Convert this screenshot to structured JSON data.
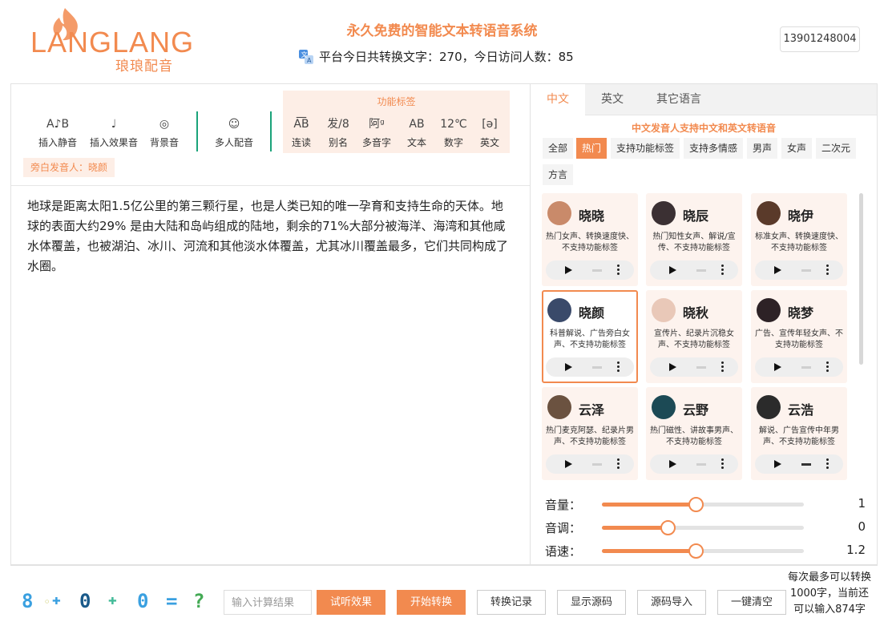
{
  "brand": {
    "logo_text": "LANGLANG",
    "logo_sub": "琅琅配音"
  },
  "header": {
    "title": "永久免费的智能文本转语音系统",
    "stats": "平台今日共转换文字：270，今日访问人数：85",
    "phone": "13901248004"
  },
  "toolbar": {
    "items": [
      {
        "icon": "A♪B",
        "label": "插入静音"
      },
      {
        "icon": "♩",
        "label": "插入效果音"
      },
      {
        "icon": "◎",
        "label": "背景音"
      },
      {
        "icon": "☺",
        "label": "多人配音"
      }
    ],
    "function_tags_title": "功能标签",
    "function_tags": [
      {
        "icon": "A͞B",
        "label": "连读"
      },
      {
        "icon": "发/8",
        "label": "别名"
      },
      {
        "icon": "阿ᵍ",
        "label": "多音字"
      },
      {
        "icon": "AB",
        "label": "文本"
      },
      {
        "icon": "12℃",
        "label": "数字"
      },
      {
        "icon": "[ə]",
        "label": "英文"
      }
    ],
    "narrator": "旁白发音人：晓颜"
  },
  "editor": {
    "text": "地球是距离太阳1.5亿公里的第三颗行星，也是人类已知的唯一孕育和支持生命的天体。地球的表面大约29% 是由大陆和岛屿组成的陆地，剩余的71%大部分被海洋、海湾和其他咸水体覆盖，也被湖泊、冰川、河流和其他淡水体覆盖，尤其冰川覆盖最多，它们共同构成了水圈。"
  },
  "voice_panel": {
    "tabs": [
      "中文",
      "英文",
      "其它语言"
    ],
    "note": "中文发音人支持中文和英文转语音",
    "filters": [
      "全部",
      "热门",
      "支持功能标签",
      "支持多情感",
      "男声",
      "女声",
      "二次元",
      "方言"
    ],
    "voices": [
      {
        "name": "晓晓",
        "desc": "热门女声、转换速度快、不支持功能标签",
        "color": "#c98a6a"
      },
      {
        "name": "晓辰",
        "desc": "热门知性女声、解说/宣传、不支持功能标签",
        "color": "#3b3033"
      },
      {
        "name": "晓伊",
        "desc": "标准女声、转换速度快、不支持功能标签",
        "color": "#5a3a2a"
      },
      {
        "name": "晓颜",
        "desc": "科普解说、广告旁白女声、不支持功能标签",
        "color": "#3a4a6a"
      },
      {
        "name": "晓秋",
        "desc": "宣传片、纪录片沉稳女声、不支持功能标签",
        "color": "#e9c8b8"
      },
      {
        "name": "晓梦",
        "desc": "广告、宣传年轻女声、不支持功能标签",
        "color": "#2d2226"
      },
      {
        "name": "云泽",
        "desc": "热门麦克阿瑟、纪录片男声、不支持功能标签",
        "color": "#6b5240"
      },
      {
        "name": "云野",
        "desc": "热门磁性、讲故事男声、不支持功能标签",
        "color": "#1c4a55"
      },
      {
        "name": "云浩",
        "desc": "解说、广告宣传中年男声、不支持功能标签",
        "color": "#2b2b2b"
      }
    ],
    "sliders": [
      {
        "label": "音量：",
        "value": "1",
        "fraction": 0.47
      },
      {
        "label": "音调：",
        "value": "0",
        "fraction": 0.33
      },
      {
        "label": "语速：",
        "value": "1.2",
        "fraction": 0.47
      }
    ]
  },
  "bottom": {
    "captcha": [
      {
        "ch": "8",
        "color": "#3aa0e0"
      },
      {
        "ch": "◦",
        "color": "#cccc66"
      },
      {
        "ch": "✚",
        "color": "#3aa0e0"
      },
      {
        "ch": "0",
        "color": "#1a5a8a"
      },
      {
        "ch": "✚",
        "color": "#44bb99"
      },
      {
        "ch": "0",
        "color": "#3aa0e0"
      },
      {
        "ch": "=",
        "color": "#3aa0e0"
      },
      {
        "ch": "?",
        "color": "#44aa55"
      }
    ],
    "input_placeholder": "输入计算结果",
    "buttons": [
      "试听效果",
      "开始转换",
      "转换记录",
      "显示源码",
      "源码导入",
      "一键清空"
    ],
    "limit_note": "每次最多可以转换1000字，当前还可以输入874字"
  },
  "colors": {
    "accent": "#f28a4f",
    "accent_light": "#fdeee6",
    "divider": "#1aa37a"
  }
}
